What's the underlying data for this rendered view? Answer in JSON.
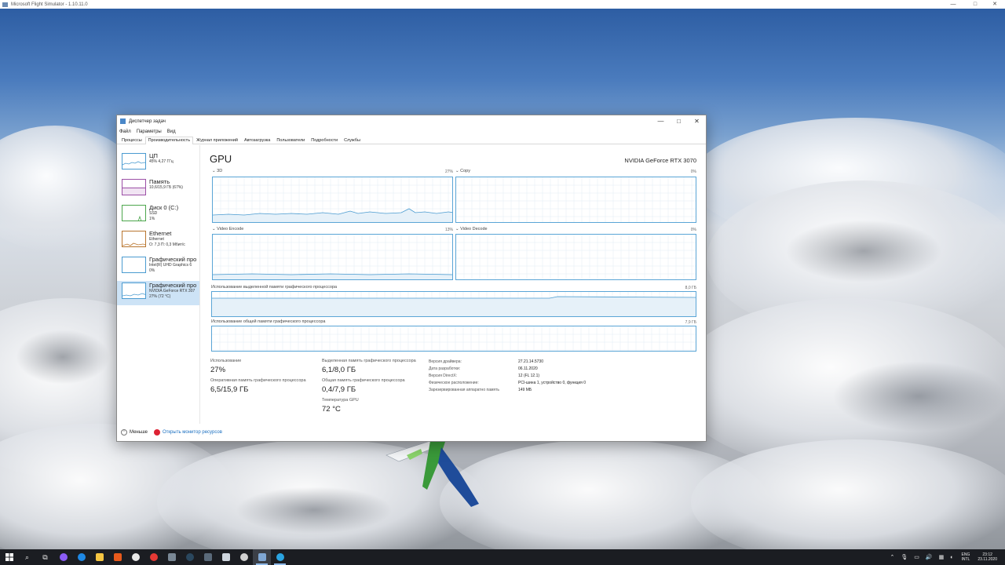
{
  "game_window": {
    "title": "Microsoft Flight Simulator - 1.10.11.0",
    "controls": [
      "—",
      "□",
      "✕"
    ]
  },
  "task_manager": {
    "title": "Диспетчер задач",
    "menu": [
      "Файл",
      "Параметры",
      "Вид"
    ],
    "tabs": [
      "Процессы",
      "Производительность",
      "Журнал приложений",
      "Автозагрузка",
      "Пользователи",
      "Подробности",
      "Службы"
    ],
    "active_tab": "Производительность",
    "sidebar": [
      {
        "name": "ЦП",
        "sub1": "45% 4,27 ГГц",
        "sub2": "",
        "color": "#4a9bd0"
      },
      {
        "name": "Память",
        "sub1": "10,6/15,9 ГБ (67%)",
        "sub2": "",
        "color": "#9b4fa6"
      },
      {
        "name": "Диск 0 (C:)",
        "sub1": "SSD",
        "sub2": "1%",
        "color": "#4ca64c"
      },
      {
        "name": "Ethernet",
        "sub1": "Ethernet",
        "sub2": "О: 7,3 П: 0,3 Мбит/с",
        "color": "#b9762f"
      },
      {
        "name": "Графический про",
        "sub1": "Intel(R) UHD Graphics 6",
        "sub2": "0%",
        "color": "#4a9bd0"
      },
      {
        "name": "Графический про",
        "sub1": "NVIDIA GeForce RTX 307",
        "sub2": "27% (72 °C)",
        "color": "#4a9bd0"
      }
    ],
    "gpu": {
      "title": "GPU",
      "model": "NVIDIA GeForce RTX 3070",
      "engines": [
        {
          "label": "3D",
          "pct": "27%"
        },
        {
          "label": "Copy",
          "pct": "0%"
        },
        {
          "label": "Video Encode",
          "pct": "13%"
        },
        {
          "label": "Video Decode",
          "pct": "0%"
        }
      ],
      "dedicated": {
        "label": "Использование выделенной памяти графического процессора",
        "max": "8,0 ГБ"
      },
      "shared": {
        "label": "Использование общей памяти графического процессора",
        "max": "7,9 ГБ"
      },
      "stats": {
        "usage_label": "Использование",
        "usage_value": "27%",
        "gpu_mem_label": "Оперативная память графического процессора",
        "gpu_mem_value": "6,5/15,9 ГБ",
        "dedicated_label": "Выделенная память графического процессора",
        "dedicated_value": "6,1/8,0 ГБ",
        "shared_label": "Общая память графического процессора",
        "shared_value": "0,4/7,9 ГБ",
        "temp_label": "Температура GPU",
        "temp_value": "72 °C"
      },
      "details": [
        {
          "k": "Версия драйвера:",
          "v": "27.21.14.5730"
        },
        {
          "k": "Дата разработки:",
          "v": "06.11.2020"
        },
        {
          "k": "Версия DirectX:",
          "v": "12 (FL 12.1)"
        },
        {
          "k": "Физическое расположение:",
          "v": "PCI-шина 1, устройство 0, функция 0"
        },
        {
          "k": "Зарезервированная аппаратно память",
          "v": "149 МБ"
        }
      ]
    },
    "footer": {
      "less": "Меньше",
      "monitor": "Открыть монитор ресурсов"
    }
  },
  "taskbar": {
    "tray": {
      "lang1": "ENG",
      "lang2": "INTL",
      "time": "23:12",
      "date": "23.11.2020"
    }
  }
}
